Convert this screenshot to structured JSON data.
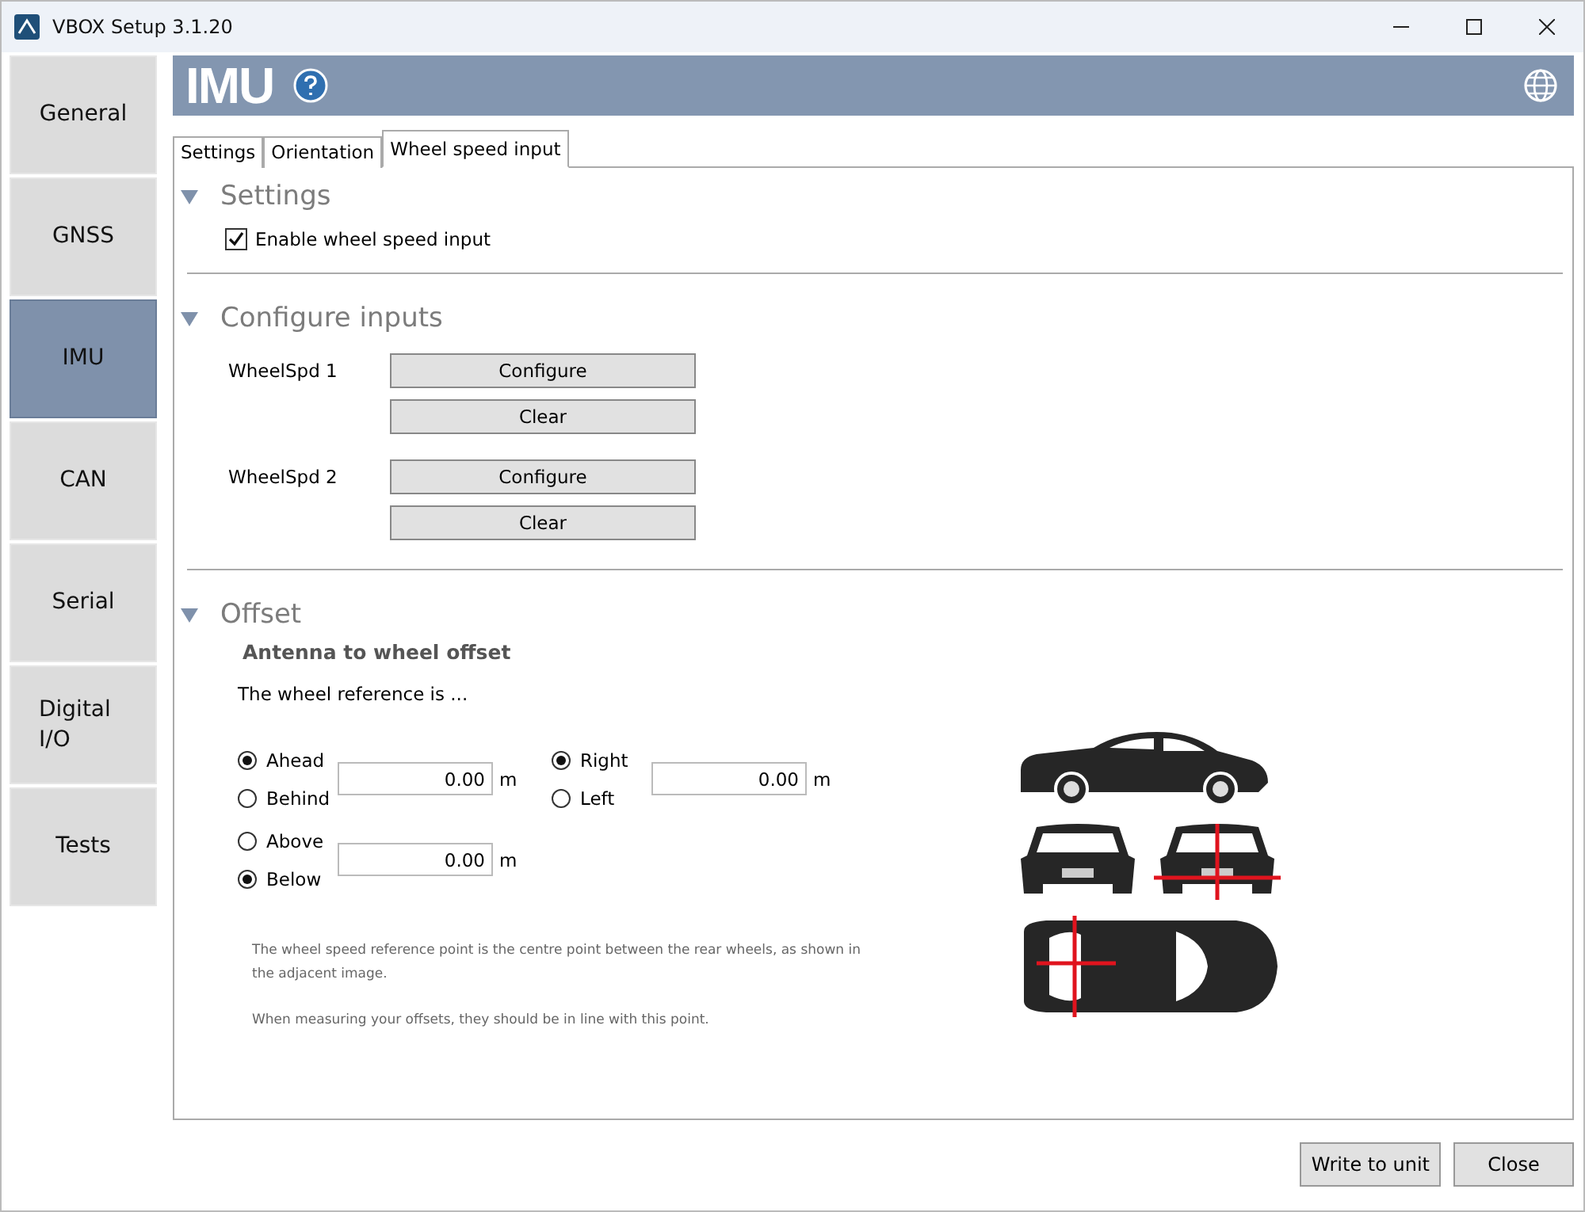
{
  "window": {
    "title": "VBOX Setup 3.1.20"
  },
  "sidebar": {
    "items": [
      {
        "label": "General",
        "selected": false
      },
      {
        "label": "GNSS",
        "selected": false
      },
      {
        "label": "IMU",
        "selected": true
      },
      {
        "label": "CAN",
        "selected": false
      },
      {
        "label": "Serial",
        "selected": false
      },
      {
        "label": "Digital I/O",
        "selected": false
      },
      {
        "label": "Tests",
        "selected": false
      }
    ]
  },
  "header": {
    "title": "IMU"
  },
  "tabs": [
    {
      "label": "Settings",
      "selected": false
    },
    {
      "label": "Orientation",
      "selected": false
    },
    {
      "label": "Wheel speed input",
      "selected": true
    }
  ],
  "settings": {
    "title": "Settings",
    "checkbox": {
      "label": "Enable wheel speed input",
      "checked": true
    }
  },
  "configure": {
    "title": "Configure inputs",
    "inputs": [
      {
        "label": "WheelSpd 1",
        "buttons": [
          "Configure",
          "Clear"
        ]
      },
      {
        "label": "WheelSpd 2",
        "buttons": [
          "Configure",
          "Clear"
        ]
      }
    ]
  },
  "offset": {
    "title": "Offset",
    "subtitle": "Antenna to wheel offset",
    "intro": "The wheel reference is ...",
    "groups": [
      {
        "options": [
          {
            "label": "Ahead",
            "selected": true
          },
          {
            "label": "Behind",
            "selected": false
          }
        ],
        "value": "0.00",
        "unit": "m"
      },
      {
        "options": [
          {
            "label": "Right",
            "selected": true
          },
          {
            "label": "Left",
            "selected": false
          }
        ],
        "value": "0.00",
        "unit": "m"
      },
      {
        "options": [
          {
            "label": "Above",
            "selected": false
          },
          {
            "label": "Below",
            "selected": true
          }
        ],
        "value": "0.00",
        "unit": "m"
      }
    ],
    "notes": [
      "The wheel speed reference point is the centre point between the rear wheels, as shown in the adjacent image.",
      "When measuring your offsets, they should be in line with this point."
    ]
  },
  "footer": {
    "buttons": [
      "Write to unit",
      "Close"
    ]
  }
}
